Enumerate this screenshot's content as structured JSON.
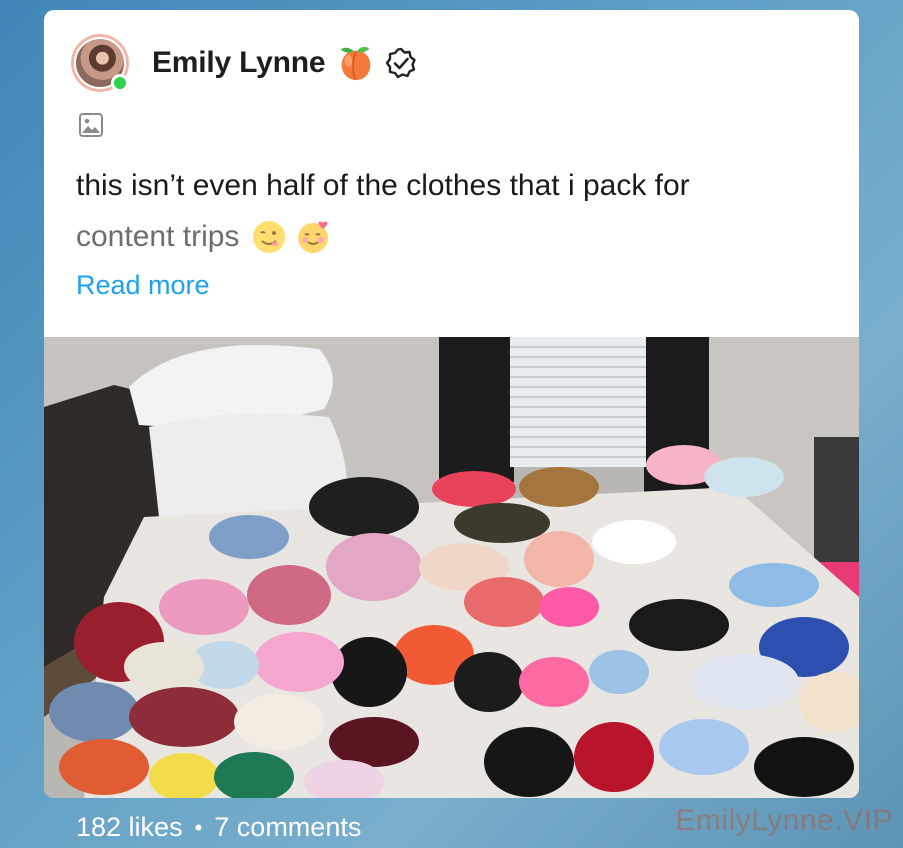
{
  "post": {
    "author_name": "Emily Lynne",
    "text_line1": "this isn’t even half of the clothes that i pack for",
    "text_line2": "content trips",
    "read_more": "Read more"
  },
  "icons": {
    "avatar": "profile-avatar",
    "online": "online-status-dot",
    "peach": "peach-emoji-icon",
    "verified": "verified-badge-icon",
    "media": "image-icon",
    "emoji1": "wink-emoji",
    "emoji2": "heart-face-emoji"
  },
  "footer": {
    "likes": "182 likes",
    "separator": "•",
    "comments": "7 comments"
  },
  "watermark": "EmilyLynne.VIP",
  "colors": {
    "link": "#1da1f2",
    "online": "#2fd24a"
  }
}
